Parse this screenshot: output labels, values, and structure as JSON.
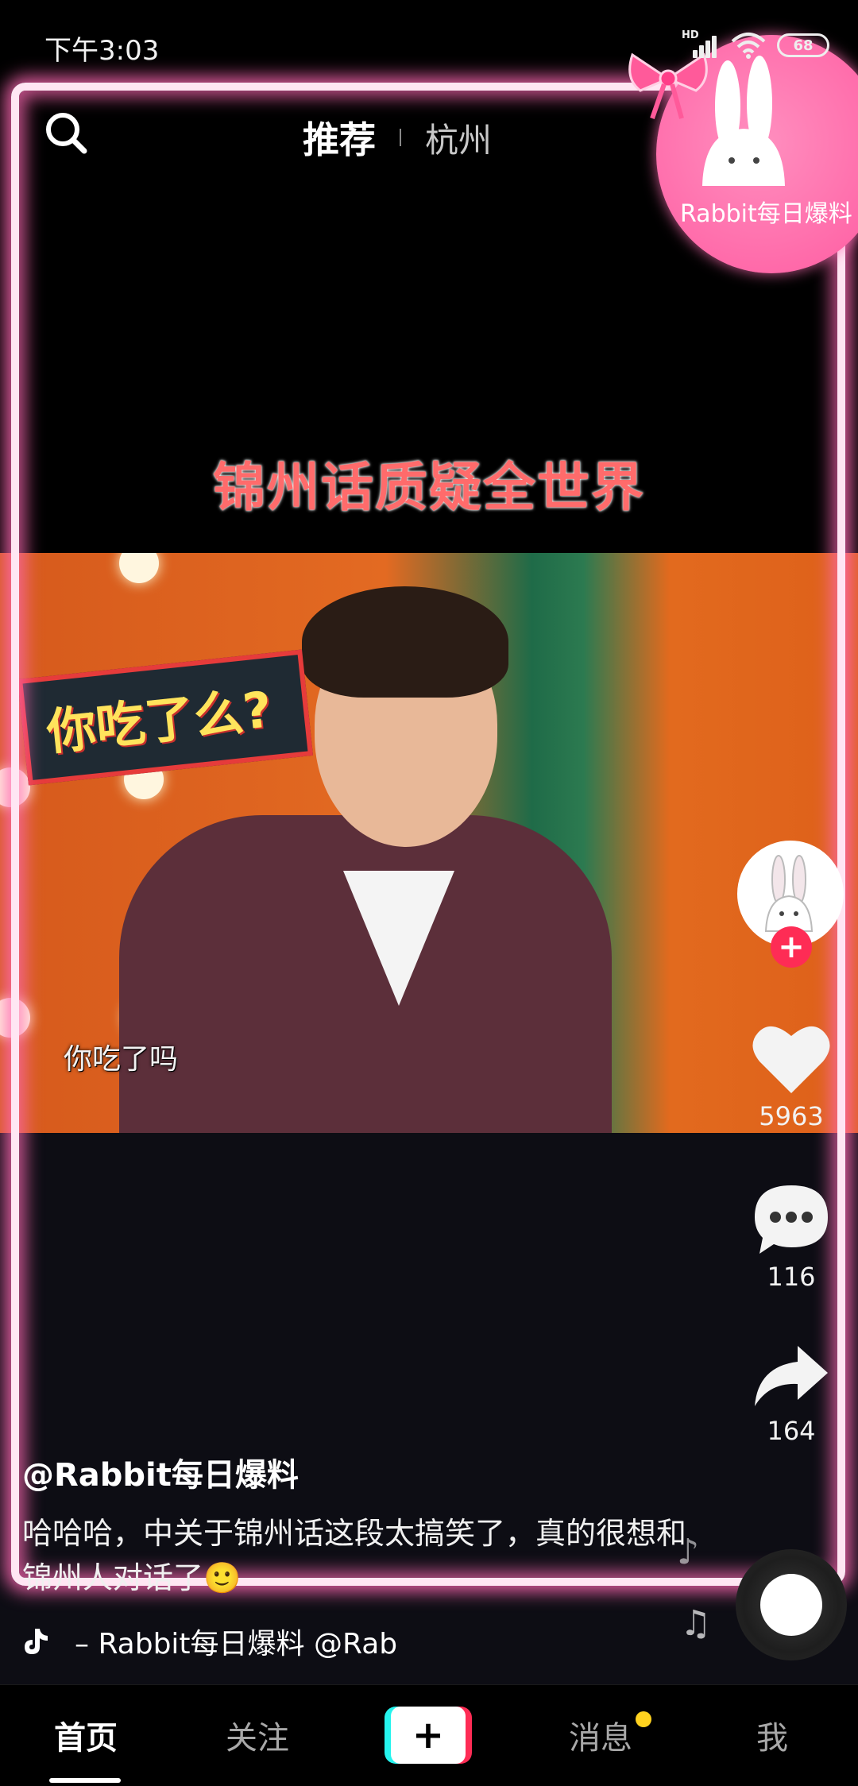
{
  "status_bar": {
    "time": "下午3:03",
    "network_badge": "HD",
    "battery": "68"
  },
  "top_bar": {
    "tabs": [
      {
        "label": "推荐",
        "active": true
      },
      {
        "label": "杭州",
        "active": false
      }
    ]
  },
  "overlay_badge": {
    "text": "Rabbit每日爆料"
  },
  "video": {
    "caption": "锦州话质疑全世界",
    "sign_text": "你吃了么?",
    "subtitle": "你吃了吗"
  },
  "actions": {
    "likes": "5963",
    "comments": "116",
    "shares": "164"
  },
  "post": {
    "author": "@Rabbit每日爆料",
    "description": "哈哈哈，中关于锦州话这段太搞笑了，真的很想和锦州人对话了🙂",
    "music": "– Rabbit每日爆料    @Rab"
  },
  "bottom_nav": {
    "items": [
      {
        "label": "首页",
        "active": true
      },
      {
        "label": "关注",
        "active": false
      },
      {
        "label": "+",
        "active": false
      },
      {
        "label": "消息",
        "active": false
      },
      {
        "label": "我",
        "active": false
      }
    ]
  },
  "colors": {
    "accent": "#fe2c55",
    "accent_alt": "#25f4ee",
    "neon": "#ff69b4",
    "notification": "#ffd21f"
  },
  "icons": [
    "search-icon",
    "heart-icon",
    "comment-icon",
    "share-icon",
    "music-note-icon",
    "tiktok-logo-icon",
    "plus-icon"
  ]
}
